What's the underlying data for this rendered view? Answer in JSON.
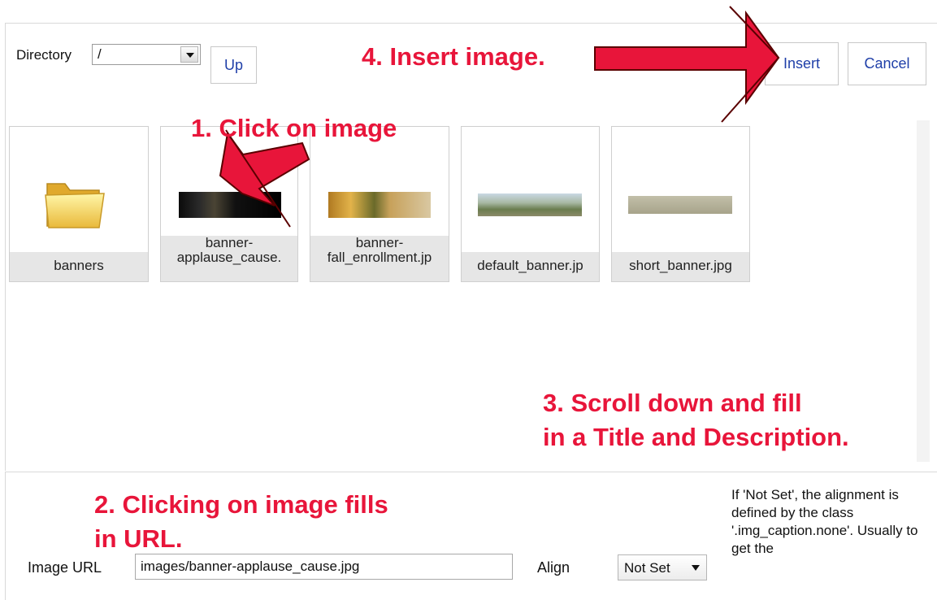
{
  "toolbar": {
    "directory_label": "Directory",
    "directory_value": "/",
    "up_label": "Up",
    "insert_label": "Insert",
    "cancel_label": "Cancel"
  },
  "browser": {
    "items": [
      {
        "caption": "banners",
        "type": "folder"
      },
      {
        "caption_line1": "banner-",
        "caption_line2": "applause_cause.",
        "type": "image"
      },
      {
        "caption_line1": "banner-",
        "caption_line2": "fall_enrollment.jp",
        "type": "image"
      },
      {
        "caption": "default_banner.jp",
        "type": "image"
      },
      {
        "caption": "short_banner.jpg",
        "type": "image"
      }
    ]
  },
  "form": {
    "image_url_label": "Image URL",
    "image_url_value": "images/banner-applause_cause.jpg",
    "align_label": "Align",
    "align_value": "Not Set",
    "align_help": "If 'Not Set', the alignment is defined by the class '.img_caption.none'. Usually to get the"
  },
  "annotations": {
    "step1": "1.  Click on image",
    "step2_line1": "2.  Clicking on image fills",
    "step2_line2": "in URL.",
    "step3_line1": "3.  Scroll down and fill",
    "step3_line2": "in a Title and Description.",
    "step4": "4.  Insert image."
  },
  "colors": {
    "annotation_red": "#e8153a",
    "button_text_blue": "#1f3fa8"
  }
}
